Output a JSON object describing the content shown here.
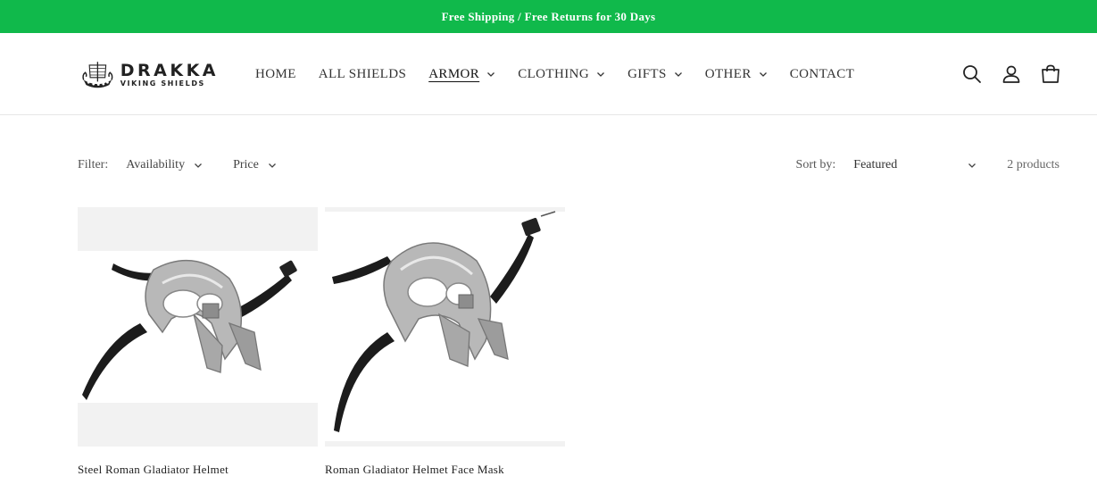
{
  "announcement": "Free Shipping / Free Returns for 30 Days",
  "brand": {
    "name": "DRAKKA",
    "tagline": "VIKING SHIELDS"
  },
  "nav": [
    {
      "label": "HOME",
      "has_menu": false,
      "active": false
    },
    {
      "label": "ALL SHIELDS",
      "has_menu": false,
      "active": false
    },
    {
      "label": "ARMOR",
      "has_menu": true,
      "active": true
    },
    {
      "label": "CLOTHING",
      "has_menu": true,
      "active": false
    },
    {
      "label": "GIFTS",
      "has_menu": true,
      "active": false
    },
    {
      "label": "OTHER",
      "has_menu": true,
      "active": false
    },
    {
      "label": "CONTACT",
      "has_menu": false,
      "active": false
    }
  ],
  "header_icons": [
    "search-icon",
    "account-icon",
    "cart-icon"
  ],
  "filters": {
    "label": "Filter:",
    "facets": [
      "Availability",
      "Price"
    ],
    "sort_label": "Sort by:",
    "sort_value": "Featured",
    "count": "2 products"
  },
  "products": [
    {
      "title": "Steel Roman Gladiator Helmet"
    },
    {
      "title": "Roman Gladiator Helmet Face Mask"
    }
  ],
  "colors": {
    "announcement_bg": "#10b94b",
    "text": "#333333"
  }
}
